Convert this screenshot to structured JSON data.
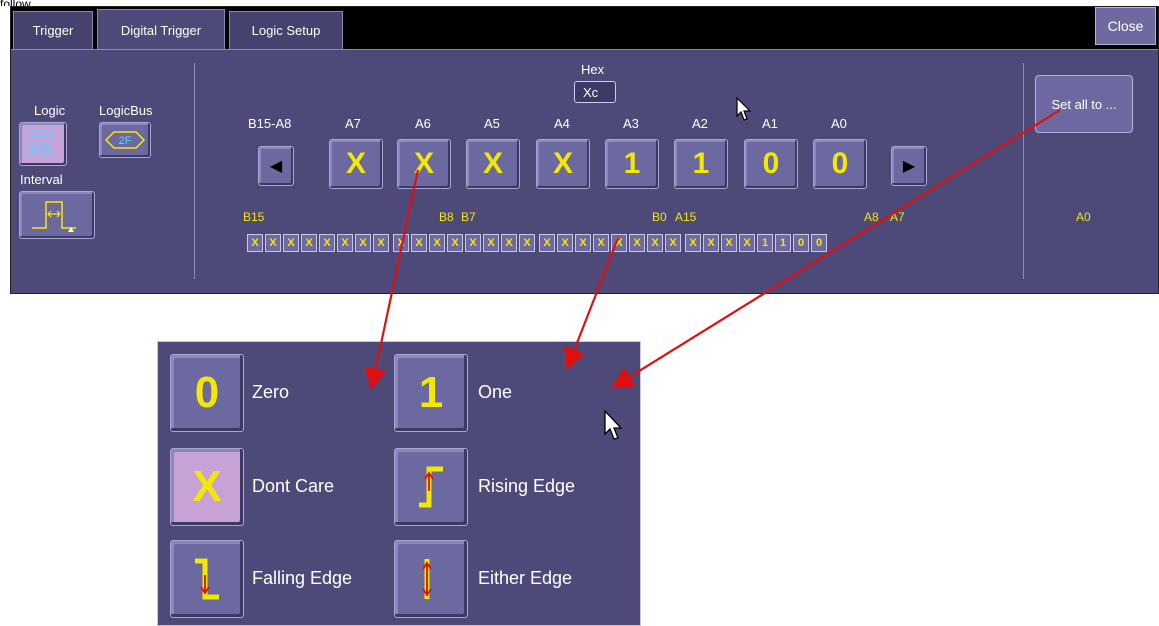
{
  "top_text": "follow",
  "tabs": [
    "Trigger",
    "Digital Trigger",
    "Logic Setup"
  ],
  "close_label": "Close",
  "left_panel": {
    "logic_label": "Logic",
    "logicbus_label": "LogicBus",
    "logicbus_value": "2F",
    "interval_label": "Interval"
  },
  "hex": {
    "label": "Hex",
    "value": "Xc"
  },
  "columns": [
    "B15-A8",
    "A7",
    "A6",
    "A5",
    "A4",
    "A3",
    "A2",
    "A1",
    "A0"
  ],
  "bits": [
    "X",
    "X",
    "X",
    "X",
    "1",
    "1",
    "0",
    "0"
  ],
  "set_all_label": "Set all to ...",
  "group_labels": {
    "b15": "B15",
    "b8": "B8",
    "b7": "B7",
    "b0": "B0",
    "a15": "A15",
    "a8": "A8",
    "a7": "A7",
    "a0": "A0"
  },
  "bit_cells": [
    "X",
    "X",
    "X",
    "X",
    "X",
    "X",
    "X",
    "X",
    "X",
    "X",
    "X",
    "X",
    "X",
    "X",
    "X",
    "X",
    "X",
    "X",
    "X",
    "X",
    "X",
    "X",
    "X",
    "X",
    "X",
    "X",
    "X",
    "X",
    "1",
    "1",
    "0",
    "0"
  ],
  "popup": {
    "options": [
      {
        "glyph": "0",
        "label": "Zero"
      },
      {
        "glyph": "1",
        "label": "One"
      },
      {
        "glyph": "X",
        "label": "Dont Care"
      },
      {
        "glyph": "rising-edge",
        "label": "Rising Edge"
      },
      {
        "glyph": "falling-edge",
        "label": "Falling Edge"
      },
      {
        "glyph": "either-edge",
        "label": "Either Edge"
      }
    ]
  },
  "colors": {
    "panel": "#4d4a7a",
    "button": "#6c68a0",
    "selected": "#c7a2d7",
    "bit_text": "#f2e800",
    "arrow": "#e01010"
  }
}
